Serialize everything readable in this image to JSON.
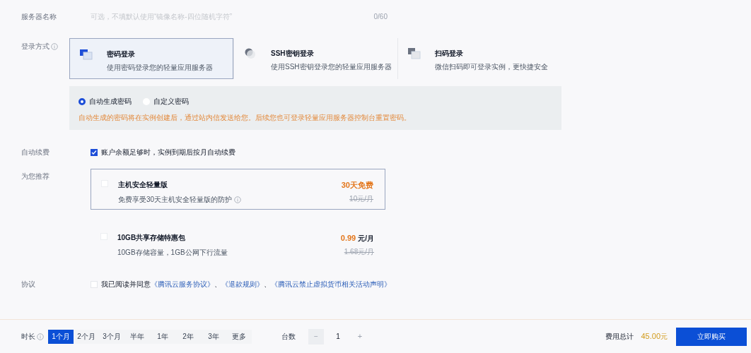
{
  "server_name": {
    "label": "服务器名称",
    "placeholder": "可选，不填默认使用“镜像名称-四位随机字符”",
    "counter": "0/60"
  },
  "login": {
    "label": "登录方式",
    "methods": [
      {
        "kind": "password",
        "title": "密码登录",
        "desc": "使用密码登录您的轻量应用服务器",
        "selected": true
      },
      {
        "kind": "ssh",
        "title": "SSH密钥登录",
        "desc": "使用SSH密钥登录您的轻量应用服务器",
        "selected": false
      },
      {
        "kind": "qr",
        "title": "扫码登录",
        "desc": "微信扫码即可登录实例，更快捷安全",
        "selected": false
      }
    ],
    "password_options": [
      {
        "label": "自动生成密码",
        "selected": true
      },
      {
        "label": "自定义密码",
        "selected": false
      }
    ],
    "notice": "自动生成的密码将在实例创建后，通过站内信发送给您。后续您也可登录轻量应用服务器控制台重置密码。"
  },
  "auto_renew": {
    "label": "自动续费",
    "checked": true,
    "text": "账户余额足够时，实例到期后按月自动续费"
  },
  "recommend": {
    "label": "为您推荐",
    "items": [
      {
        "title": "主机安全轻量版",
        "desc": "免费享受30天主机安全轻量版的防护",
        "has_info": true,
        "checked": false,
        "selected": true,
        "price": "30天免费",
        "original_price": "10元/月"
      },
      {
        "title": "10GB共享存储特惠包",
        "desc": "10GB存储容量，1GB公网下行流量",
        "has_info": false,
        "checked": false,
        "selected": false,
        "price": "0.99",
        "price_unit": "元/月",
        "original_price": "1.68元/月"
      }
    ]
  },
  "agreement": {
    "label": "协议",
    "checked": false,
    "parts": [
      {
        "kind": "text",
        "text": "我已阅读并同意"
      },
      {
        "kind": "link",
        "text": "《腾讯云服务协议》"
      },
      {
        "kind": "text",
        "text": "、"
      },
      {
        "kind": "link",
        "text": "《退款规则》"
      },
      {
        "kind": "text",
        "text": "、"
      },
      {
        "kind": "link",
        "text": "《腾讯云禁止虚拟货币相关活动声明》"
      }
    ]
  },
  "footer": {
    "duration_label": "时长",
    "durations": [
      {
        "label": "1个月",
        "selected": true
      },
      {
        "label": "2个月",
        "selected": false
      },
      {
        "label": "3个月",
        "selected": false
      },
      {
        "label": "半年",
        "selected": false
      },
      {
        "label": "1年",
        "selected": false
      },
      {
        "label": "2年",
        "selected": false
      },
      {
        "label": "3年",
        "selected": false
      },
      {
        "label": "更多",
        "selected": false
      }
    ],
    "quantity_label": "台数",
    "minus": "−",
    "quantity": "1",
    "plus": "+",
    "total_label": "费用总计",
    "total": "45.00",
    "currency": "元",
    "buy_button": "立即购买"
  }
}
